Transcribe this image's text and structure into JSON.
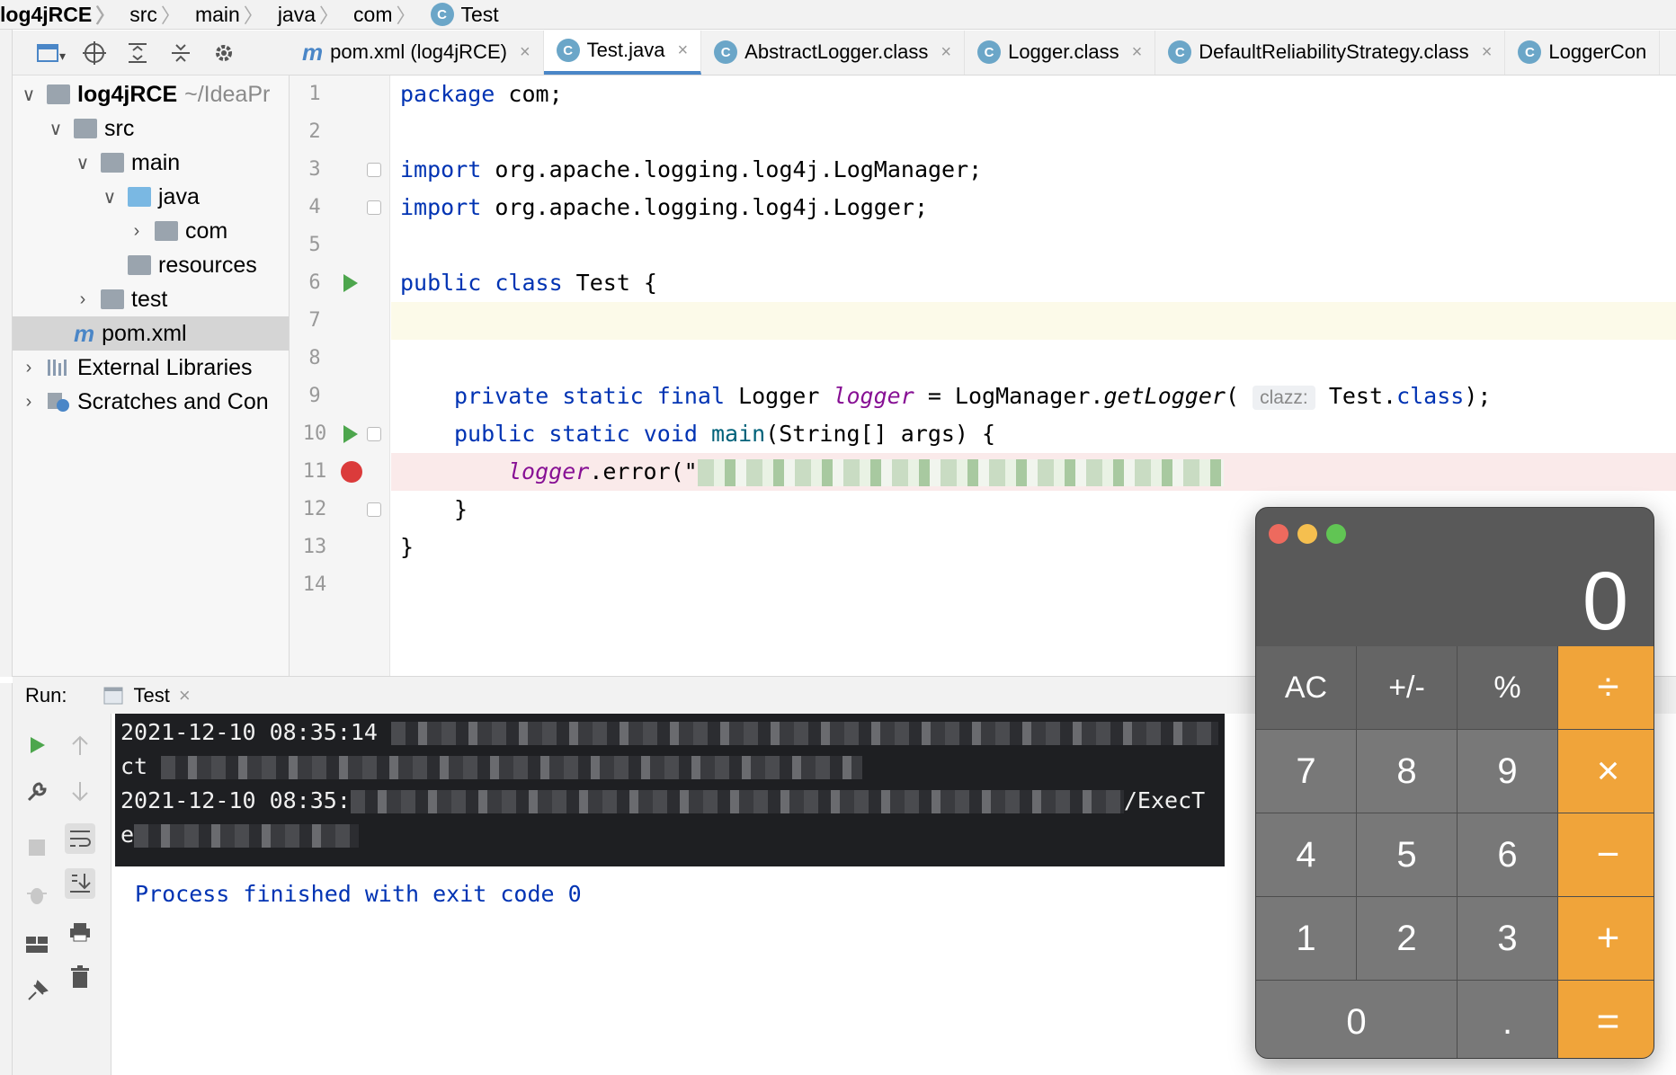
{
  "breadcrumbs": [
    "log4jRCE",
    "src",
    "main",
    "java",
    "com",
    "Test"
  ],
  "class_icon_letter": "C",
  "tabs": [
    {
      "label": "pom.xml (log4jRCE)",
      "icon": "m"
    },
    {
      "label": "Test.java",
      "icon": "C"
    },
    {
      "label": "AbstractLogger.class",
      "icon": "C"
    },
    {
      "label": "Logger.class",
      "icon": "C"
    },
    {
      "label": "DefaultReliabilityStrategy.class",
      "icon": "C"
    },
    {
      "label": "LoggerCon",
      "icon": "C"
    }
  ],
  "tab_close": "×",
  "tree": {
    "root": "log4jRCE",
    "root_path": "~/IdeaPr",
    "src": "src",
    "main": "main",
    "java": "java",
    "com": "com",
    "resources": "resources",
    "test": "test",
    "pom": "pom.xml",
    "pom_icon": "m",
    "ext": "External Libraries",
    "scratch": "Scratches and Con"
  },
  "line_numbers": [
    "1",
    "2",
    "3",
    "4",
    "5",
    "6",
    "7",
    "8",
    "9",
    "10",
    "11",
    "12",
    "13",
    "14"
  ],
  "code": {
    "l1_kw": "package",
    "l1_rest": " com;",
    "l3_kw": "import",
    "l3_rest": " org.apache.logging.log4j.LogManager;",
    "l4_kw": "import",
    "l4_rest": " org.apache.logging.log4j.Logger;",
    "l6_kw": "public class",
    "l6_rest": " Test {",
    "l9_kw": "private static final",
    "l9_type": " Logger ",
    "l9_var": "logger",
    "l9_mid": " = LogManager.",
    "l9_fn": "getLogger",
    "l9_paren": "(",
    "l9_hint": "clazz:",
    "l9_arg": " Test.",
    "l9_cls": "class",
    "l9_end": ");",
    "l10_kw": "public static void",
    "l10_fn": " main",
    "l10_rest": "(String[] args) {",
    "l11_var": "logger",
    "l11_rest": ".error(\"",
    "l12": "}",
    "l13": "}"
  },
  "run": {
    "label": "Run:",
    "tab": "Test",
    "console": [
      "2021-12-10 08:35:14",
      "ct",
      "2021-12-10 08:35:",
      "e"
    ],
    "console_tail": "/ExecT",
    "process": "Process finished with exit code 0"
  },
  "calculator": {
    "display": "0",
    "keys": [
      "AC",
      "+/-",
      "%",
      "÷",
      "7",
      "8",
      "9",
      "×",
      "4",
      "5",
      "6",
      "−",
      "1",
      "2",
      "3",
      "+",
      "0",
      ".",
      "="
    ]
  },
  "colors": {
    "accent": "#4a86c7",
    "keyword": "#0033b3",
    "run_green": "#4da64d",
    "breakpoint": "#db3b3b",
    "calc_orange": "#f0a43a"
  }
}
